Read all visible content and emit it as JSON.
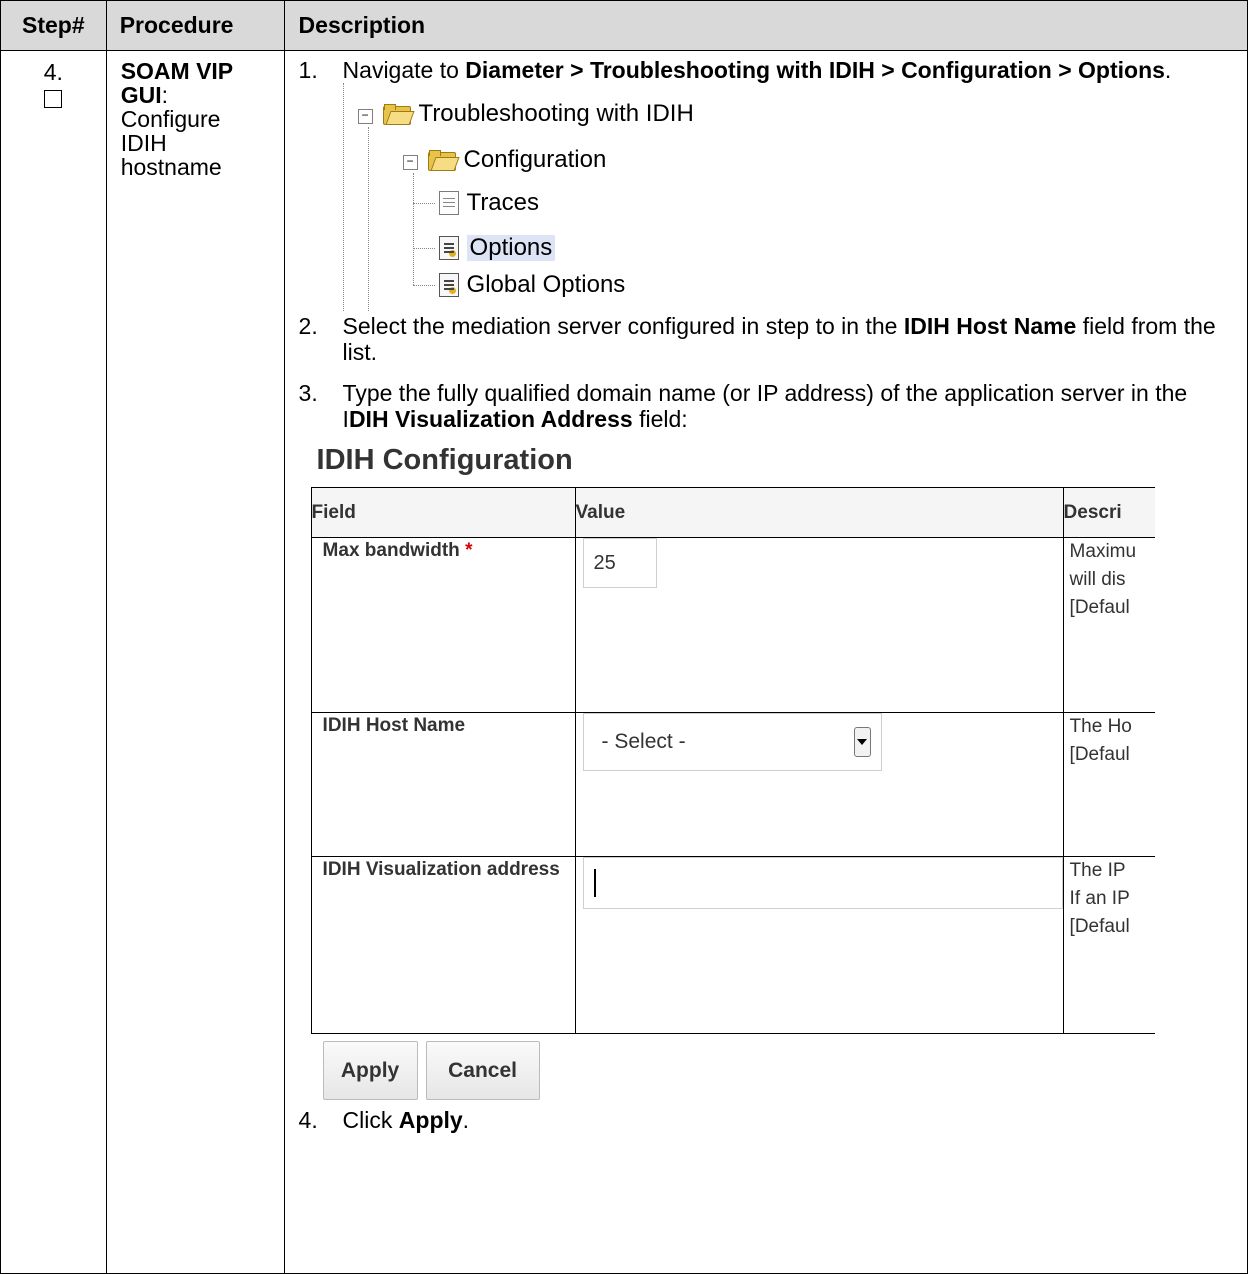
{
  "header": {
    "step": "Step#",
    "procedure": "Procedure",
    "description": "Description"
  },
  "row": {
    "step_number": "4.",
    "procedure_bold": "SOAM VIP GUI",
    "procedure_colon": ":",
    "procedure_text": "Configure IDIH hostname"
  },
  "instructions": {
    "s1_num": "1.",
    "s1_pre": "Navigate to ",
    "s1_path": "Diameter > Troubleshooting with IDIH > Configuration  > Options",
    "s1_post": ".",
    "s2_num": "2.",
    "s2_pre": "Select the mediation server configured in step to in the ",
    "s2_bold": "IDIH Host Name",
    "s2_post": " field from the list.",
    "s3_num": "3.",
    "s3_pre": "Type the fully qualified domain name (or IP address) of the application server in the I",
    "s3_bold": "DIH Visualization Address",
    "s3_post": " field:",
    "s4_num": "4.",
    "s4_pre": "Click ",
    "s4_bold": "Apply",
    "s4_post": "."
  },
  "tree": {
    "root": "Troubleshooting with IDIH",
    "config": "Configuration",
    "traces": "Traces",
    "options": "Options",
    "global_options": "Global Options",
    "collapse_symbol": "−"
  },
  "panel": {
    "title": "IDIH Configuration",
    "columns": {
      "field": "Field",
      "value": "Value",
      "description": "Descri"
    },
    "rows": {
      "bandwidth": {
        "field": "Max bandwidth",
        "required": "*",
        "value": "25",
        "desc": [
          "Maximu",
          "will dis",
          "[Defaul"
        ]
      },
      "hostname": {
        "field": "IDIH Host Name",
        "value": "- Select -",
        "desc": [
          "The Ho",
          "[Defaul"
        ]
      },
      "viz": {
        "field": "IDIH Visualization address",
        "value": "",
        "desc": [
          "The IP",
          "If an IP",
          "[Defaul"
        ]
      }
    },
    "apply": "Apply",
    "cancel": "Cancel"
  }
}
